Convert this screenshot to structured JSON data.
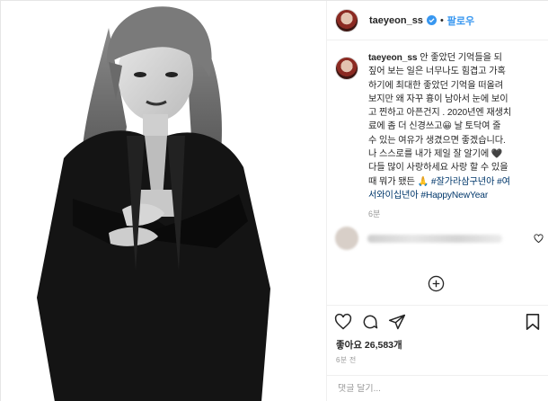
{
  "profile": {
    "username": "taeyeon_ss",
    "separator": "•",
    "follow_label": "팔로우",
    "verified_icon": "verified-badge-icon"
  },
  "caption": {
    "lines": [
      "안 좋았던 기억들을 되",
      "짚어 보는 일은 너무나도 힘겹고 가혹",
      "하기에 최대한 좋았던 기억을 떠올려",
      "보지만 왜 자꾸 흉이 남아서 눈에 보이",
      "고 찐하고 아픈건지 . 2020년엔 재생치",
      "료에 좀 더 신경쓰고😀 날 토닥여 줄",
      "수 있는 여유가 생겼으면 좋겠습니다.",
      "나 스스로를 내가 제일 잘 알기에 🖤",
      "다들 많이 사랑하세요 사랑 할 수 있을",
      "때 뭐가 됐든 🙏 "
    ],
    "hashtag1": "#잘가라삼구년아",
    "hashtag2_line1": "#여",
    "hashtag2_line2": "서와이십년아",
    "hashtag3": "#HappyNewYear",
    "time": "6분"
  },
  "actions": {
    "like_icon": "heart-icon",
    "comment_icon": "comment-icon",
    "share_icon": "share-icon",
    "save_icon": "bookmark-icon",
    "likes_text": "좋아요 26,583개",
    "time_text": "6분 전"
  },
  "comment_input": {
    "placeholder": "댓글 달기..."
  },
  "colors": {
    "link": "#3897f0",
    "hashtag": "#00376b",
    "border": "#efefef",
    "muted": "#999999"
  }
}
